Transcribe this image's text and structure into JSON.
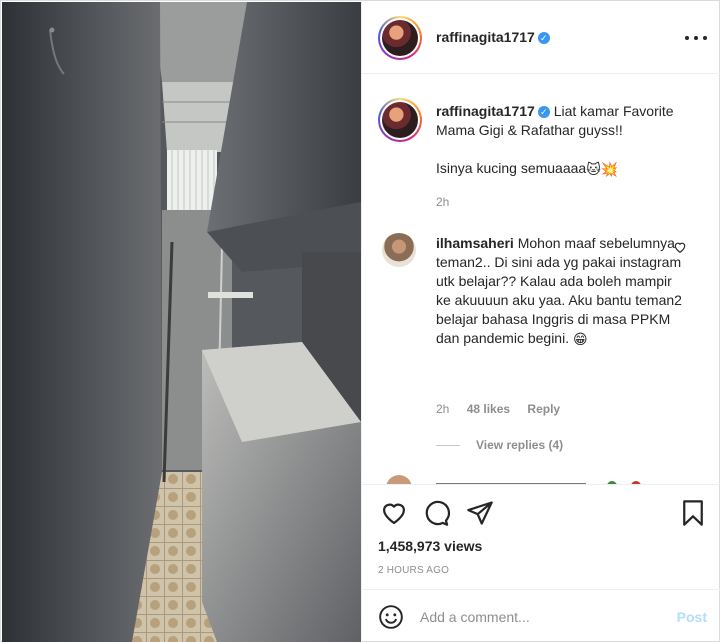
{
  "post": {
    "username": "raffinagita1717",
    "verified_icon": "verified-badge-icon",
    "more_icon": "more-options-icon"
  },
  "caption": {
    "username": "raffinagita1717",
    "text_line1": "Liat kamar Favorite Mama Gigi & Rafathar guyss!!",
    "text_line2": "Isinya kucing semuaaaa",
    "emojis": "🐱💥",
    "time": "2h"
  },
  "comment": {
    "username": "ilhamsaheri",
    "text": "Mohon maaf sebelumnya teman2.. Di sini ada yg pakai instagram utk belajar?? Kalau ada boleh mampir ke akuuuun aku yaa. Aku bantu teman2 belajar bahasa Inggris di masa PPKM dan pandemic begini.",
    "emoji": "😁",
    "time": "2h",
    "likes": "48 likes",
    "reply": "Reply",
    "view_replies": "View replies (4)"
  },
  "actions": {
    "icons": [
      "heart-icon",
      "comment-icon",
      "share-icon",
      "bookmark-icon"
    ],
    "views": "1,458,973 views",
    "posted": "2 HOURS AGO"
  },
  "add_comment": {
    "placeholder": "Add a comment...",
    "post_label": "Post",
    "post_color": "#b2dffc"
  },
  "colors": {
    "text": "#262626",
    "muted": "#8e8e8e",
    "verified": "#3897f0",
    "border": "#efefef"
  }
}
